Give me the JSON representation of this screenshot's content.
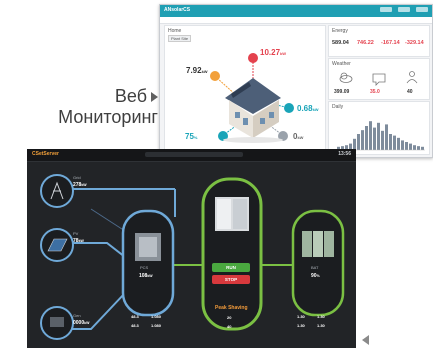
{
  "caption": {
    "line1": "Веб",
    "line2": "Мониторинг"
  },
  "web": {
    "brand": "ANsolarCS",
    "tab_main": "Home",
    "button": "Plant Site",
    "values": {
      "pv": {
        "value": "7.92",
        "unit": "kW"
      },
      "load": {
        "value": "10.27",
        "unit": "kW"
      },
      "grid": {
        "value": "0.68",
        "unit": "kW"
      },
      "battery": {
        "value": "75",
        "unit": "%"
      },
      "battery_power": {
        "value": "0",
        "unit": "kW"
      }
    },
    "summary": {
      "title": "Energy",
      "items": [
        {
          "value": "589.04",
          "color": "#333333"
        },
        {
          "value": "746.22",
          "color": "#e4424e"
        },
        {
          "value": "-167.14",
          "color": "#e4424e"
        },
        {
          "value": "-329.14",
          "color": "#e4424e"
        }
      ]
    },
    "weather": {
      "title": "Weather",
      "items": [
        {
          "value": "399.09",
          "icon": "cloud-icon"
        },
        {
          "value": "35.0",
          "icon": "sun-icon"
        },
        {
          "value": "40",
          "icon": "person-icon"
        }
      ]
    },
    "chart": {
      "title": "Daily",
      "bars": [
        0.1,
        0.12,
        0.15,
        0.2,
        0.35,
        0.5,
        0.62,
        0.75,
        0.9,
        0.7,
        0.85,
        0.6,
        0.8,
        0.5,
        0.45,
        0.38,
        0.3,
        0.25,
        0.2,
        0.15,
        0.12,
        0.1
      ]
    }
  },
  "dark": {
    "brand": "CSetServer",
    "status": "13:56",
    "grid": {
      "label": "Grid",
      "value": "278",
      "unit": "kW"
    },
    "pv": {
      "label": "PV",
      "value": "78",
      "unit": "kW"
    },
    "generator": {
      "label": "Gen",
      "value": "0000",
      "unit": "kW"
    },
    "pcs": {
      "label": "PCS",
      "value": "108",
      "unit": "kW"
    },
    "battery": {
      "label": "BAT",
      "value": "90",
      "unit": "%"
    },
    "ess": {
      "run_label": "RUN",
      "stop_label": "STOP",
      "mode": "Peak Shaving"
    },
    "stats_left": [
      "48.3",
      "1.080",
      "48.3",
      "1.080"
    ],
    "stats_mid": [
      "20",
      "40"
    ],
    "stats_right": [
      "1.30",
      "1.30",
      "1.30",
      "1.30"
    ]
  }
}
